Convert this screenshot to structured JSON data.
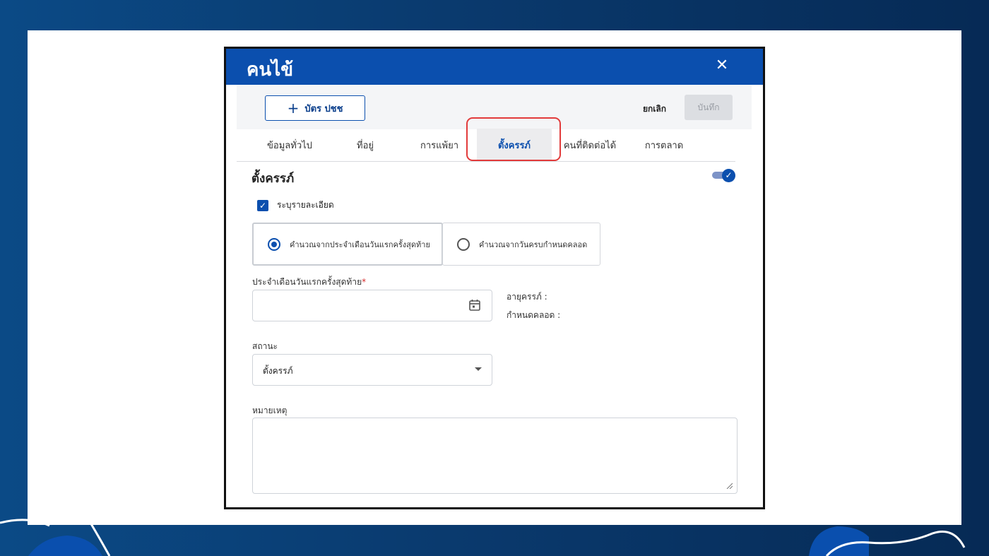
{
  "dialog": {
    "title": "คนไข้",
    "close_icon": "close-icon"
  },
  "toolbar": {
    "id_card_label": "บัตร ปชช",
    "cancel_label": "ยกเลิก",
    "save_label": "บันทึก"
  },
  "tabs": [
    {
      "label": "ข้อมูลทั่วไป",
      "active": false
    },
    {
      "label": "ที่อยู่",
      "active": false
    },
    {
      "label": "การแพ้ยา",
      "active": false
    },
    {
      "label": "ตั้งครรภ์",
      "active": true
    },
    {
      "label": "คนที่ติดต่อได้",
      "active": false
    },
    {
      "label": "การตลาด",
      "active": false
    }
  ],
  "pregnancy": {
    "section_title": "ตั้งครรภ์",
    "toggle_on": true,
    "specify_details_label": "ระบุรายละเอียด",
    "specify_details_checked": true,
    "calc_options": [
      {
        "label": "คำนวณจากประจำเดือนวันแรกครั้งสุดท้าย",
        "selected": true
      },
      {
        "label": "คำนวณจากวันครบกำหนดคลอด",
        "selected": false
      }
    ],
    "lmp_label": "ประจำเดือนวันแรกครั้งสุดท้าย",
    "lmp_required_mark": "*",
    "lmp_value": "",
    "gestational_age_label": "อายุครรภ์ :",
    "due_date_label": "กำหนดคลอด :",
    "status_label": "สถานะ",
    "status_value": "ตั้งครรภ์",
    "note_label": "หมายเหตุ",
    "note_value": ""
  },
  "colors": {
    "primary": "#0b4fae",
    "highlight": "#e23b3b",
    "background_dark": "#0a3a6e"
  }
}
